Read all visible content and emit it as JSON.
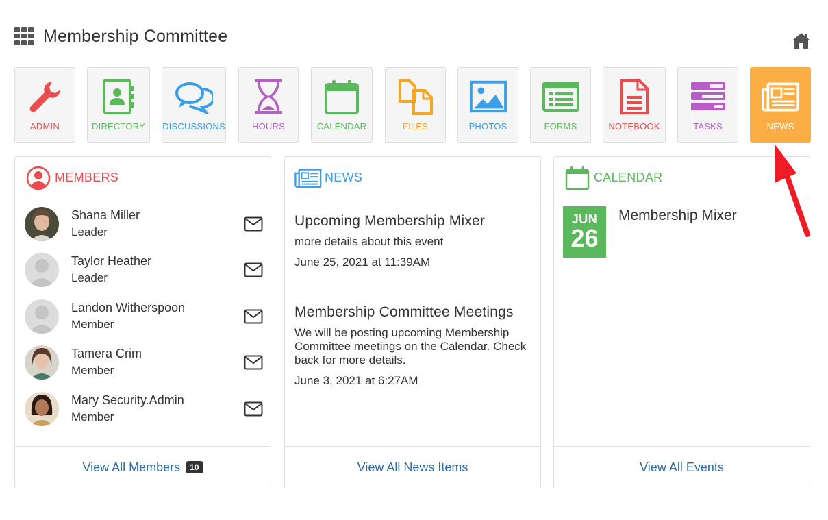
{
  "header": {
    "title": "Membership Committee",
    "apps_icon": "grid-icon",
    "home_icon": "home-icon"
  },
  "tiles": [
    {
      "label": "ADMIN",
      "icon": "wrench-icon",
      "color": "#e84c4c"
    },
    {
      "label": "DIRECTORY",
      "icon": "address-book-icon",
      "color": "#5cb85c"
    },
    {
      "label": "DISCUSSIONS",
      "icon": "chat-bubbles-icon",
      "color": "#3a9ee8"
    },
    {
      "label": "HOURS",
      "icon": "hourglass-icon",
      "color": "#b85cc8"
    },
    {
      "label": "CALENDAR",
      "icon": "calendar-icon",
      "color": "#5cb85c"
    },
    {
      "label": "FILES",
      "icon": "files-icon",
      "color": "#f5a623"
    },
    {
      "label": "PHOTOS",
      "icon": "photo-icon",
      "color": "#3a9ee8"
    },
    {
      "label": "FORMS",
      "icon": "form-icon",
      "color": "#5cb85c"
    },
    {
      "label": "NOTEBOOK",
      "icon": "document-icon",
      "color": "#e84c4c"
    },
    {
      "label": "TASKS",
      "icon": "tasks-icon",
      "color": "#b85cc8"
    },
    {
      "label": "NEWS",
      "icon": "newspaper-icon",
      "color": "#fcae45",
      "active": true
    }
  ],
  "members_panel": {
    "title": "MEMBERS",
    "color": "#e84c4c",
    "members": [
      {
        "name": "Shana Miller",
        "role": "Leader"
      },
      {
        "name": "Taylor Heather",
        "role": "Leader"
      },
      {
        "name": "Landon Witherspoon",
        "role": "Member"
      },
      {
        "name": "Tamera Crim",
        "role": "Member"
      },
      {
        "name": "Mary Security.Admin",
        "role": "Member"
      }
    ],
    "footer_link": "View All Members",
    "count": "10"
  },
  "news_panel": {
    "title": "NEWS",
    "color": "#3a9ee8",
    "items": [
      {
        "title": "Upcoming Membership Mixer",
        "desc": "more details about this event",
        "date": "June 25, 2021 at 11:39AM"
      },
      {
        "title": "Membership Committee Meetings",
        "desc": "We will be posting upcoming Membership Committee meetings on the Calendar. Check back for more details.",
        "date": "June 3, 2021 at 6:27AM"
      }
    ],
    "footer_link": "View All News Items"
  },
  "calendar_panel": {
    "title": "CALENDAR",
    "color": "#5cb85c",
    "event": {
      "month": "JUN",
      "day": "26",
      "title": "Membership Mixer"
    },
    "footer_link": "View All Events"
  }
}
